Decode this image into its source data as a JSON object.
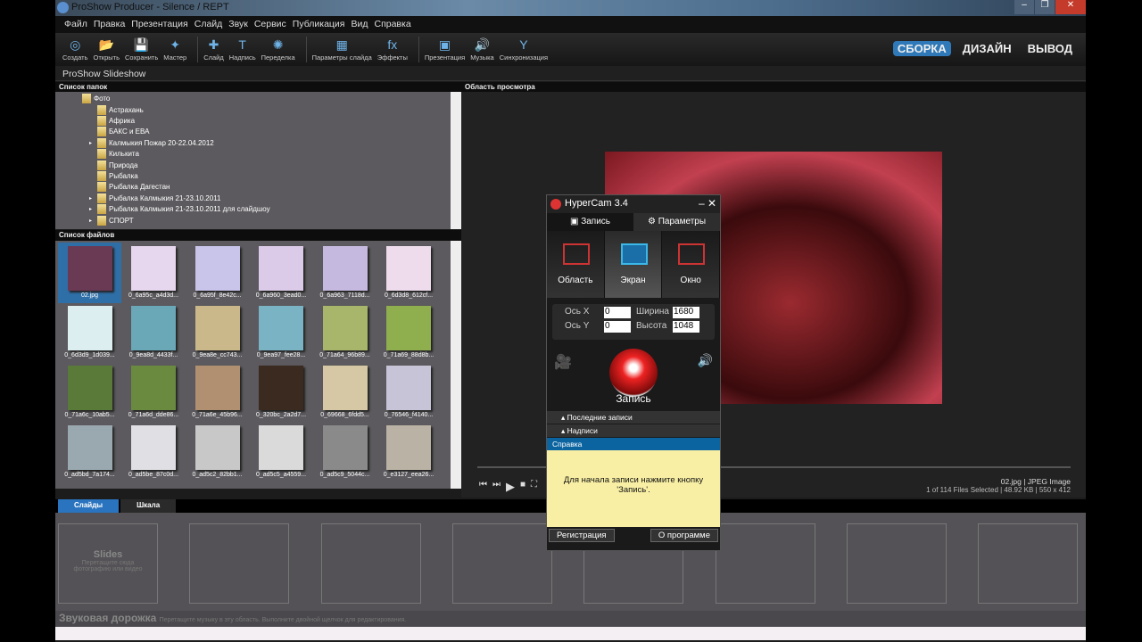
{
  "window": {
    "title": "ProShow Producer - Silence / REPT"
  },
  "menu": [
    "Файл",
    "Правка",
    "Презентация",
    "Слайд",
    "Звук",
    "Сервис",
    "Публикация",
    "Вид",
    "Справка"
  ],
  "toolbar": [
    {
      "label": "Создать",
      "icon": "disc-icon"
    },
    {
      "label": "Открыть",
      "icon": "folder-open-icon"
    },
    {
      "label": "Сохранить",
      "icon": "save-icon"
    },
    {
      "label": "Мастер",
      "icon": "wizard-icon"
    },
    {
      "label": "Слайд",
      "icon": "add-slide-icon"
    },
    {
      "label": "Надпись",
      "icon": "add-caption-icon"
    },
    {
      "label": "Переделка",
      "icon": "remix-icon"
    },
    {
      "label": "Параметры слайда",
      "icon": "slide-options-icon"
    },
    {
      "label": "Эффекты",
      "icon": "fx-icon"
    },
    {
      "label": "Презентация",
      "icon": "show-icon"
    },
    {
      "label": "Музыка",
      "icon": "music-icon"
    },
    {
      "label": "Синхронизация",
      "icon": "sync-icon"
    }
  ],
  "modes": [
    "СБОРКА",
    "ДИЗАЙН",
    "ВЫВОД"
  ],
  "project": "ProShow Slideshow",
  "folders": {
    "header": "Список папок",
    "root": "Фото",
    "items": [
      {
        "name": "Астрахань",
        "expand": false
      },
      {
        "name": "Африка",
        "expand": false
      },
      {
        "name": "БАКС и ЕВА",
        "expand": false
      },
      {
        "name": "Калмыкия Пожар 20-22.04.2012",
        "expand": true
      },
      {
        "name": "Килькита",
        "expand": false
      },
      {
        "name": "Природа",
        "expand": false
      },
      {
        "name": "Рыбалка",
        "expand": false
      },
      {
        "name": "Рыбалка Дагестан",
        "expand": false
      },
      {
        "name": "Рыбалка Калмыкия 21-23.10.2011",
        "expand": true
      },
      {
        "name": "Рыбалка Калмыкия 21-23.10.2011 для слайдшоу",
        "expand": true
      },
      {
        "name": "СПОРТ",
        "expand": true
      }
    ]
  },
  "files": {
    "header": "Список файлов",
    "items": [
      {
        "name": "02.jpg",
        "color": "#6a3a55"
      },
      {
        "name": "0_6a95c_a4d3d...",
        "color": "#e6d6ee"
      },
      {
        "name": "0_6a95f_8e42c...",
        "color": "#c8c4ea"
      },
      {
        "name": "0_6a960_3ead0...",
        "color": "#dccbe8"
      },
      {
        "name": "0_6a963_7118d...",
        "color": "#c5b9e0"
      },
      {
        "name": "0_6d3d8_612cf...",
        "color": "#eedcec"
      },
      {
        "name": "0_6d3d9_1d039...",
        "color": "#dceef0"
      },
      {
        "name": "0_9ea8d_4433f...",
        "color": "#6aa8b8"
      },
      {
        "name": "0_9ea8e_cc743...",
        "color": "#cbb88a"
      },
      {
        "name": "0_9ea97_fee28...",
        "color": "#7ab4c4"
      },
      {
        "name": "0_71a64_96b89...",
        "color": "#a7b66a"
      },
      {
        "name": "0_71a69_88d8b...",
        "color": "#8fae4e"
      },
      {
        "name": "0_71a6c_10ab5...",
        "color": "#5a7a3a"
      },
      {
        "name": "0_71a6d_dde86...",
        "color": "#6a8a40"
      },
      {
        "name": "0_71a6e_45b96...",
        "color": "#b09070"
      },
      {
        "name": "0_320bc_2a2d7...",
        "color": "#3a2a20"
      },
      {
        "name": "0_69668_6fdd5...",
        "color": "#d6c8a4"
      },
      {
        "name": "0_76546_f4140...",
        "color": "#c8c4d8"
      },
      {
        "name": "0_ad5bd_7a174...",
        "color": "#9aa8b0"
      },
      {
        "name": "0_ad5be_87c0d...",
        "color": "#e0e0e4"
      },
      {
        "name": "0_ad5c2_82bb1...",
        "color": "#c8c8c8"
      },
      {
        "name": "0_ad5c5_a4559...",
        "color": "#dadada"
      },
      {
        "name": "0_ad5c9_5044c...",
        "color": "#8a8a8a"
      },
      {
        "name": "0_e3127_eea26...",
        "color": "#bab2a4"
      }
    ]
  },
  "preview": {
    "header": "Область просмотра",
    "file": "02.jpg  |  JPEG Image",
    "details": "1 of 114 Files Selected |  48.92 KB  |  550 x 412",
    "playback_position": 0
  },
  "bottom": {
    "tabs": [
      "Слайды",
      "Шкала"
    ],
    "slides_title": "Slides",
    "slides_hint": "Перетащите сюда фотографию или видео",
    "audio_title": "Звуковая дорожка",
    "audio_hint": "Перетащите музыку в эту область. Выполните двойной щелчок для редактирования."
  },
  "hypercam": {
    "title": "HyperCam 3.4",
    "tabs": [
      "Запись",
      "Параметры"
    ],
    "modes": [
      "Область",
      "Экран",
      "Окно"
    ],
    "x_label": "Ось X",
    "x": "0",
    "y_label": "Ось Y",
    "y": "0",
    "w_label": "Ширина",
    "w": "1680",
    "h_label": "Высота",
    "h": "1048",
    "record": "Запись",
    "sections": [
      "Последние записи",
      "Надписи"
    ],
    "help": "Справка",
    "help_text": "Для начала записи нажмите кнопку 'Запись'.",
    "register": "Регистрация",
    "about": "О программе"
  }
}
